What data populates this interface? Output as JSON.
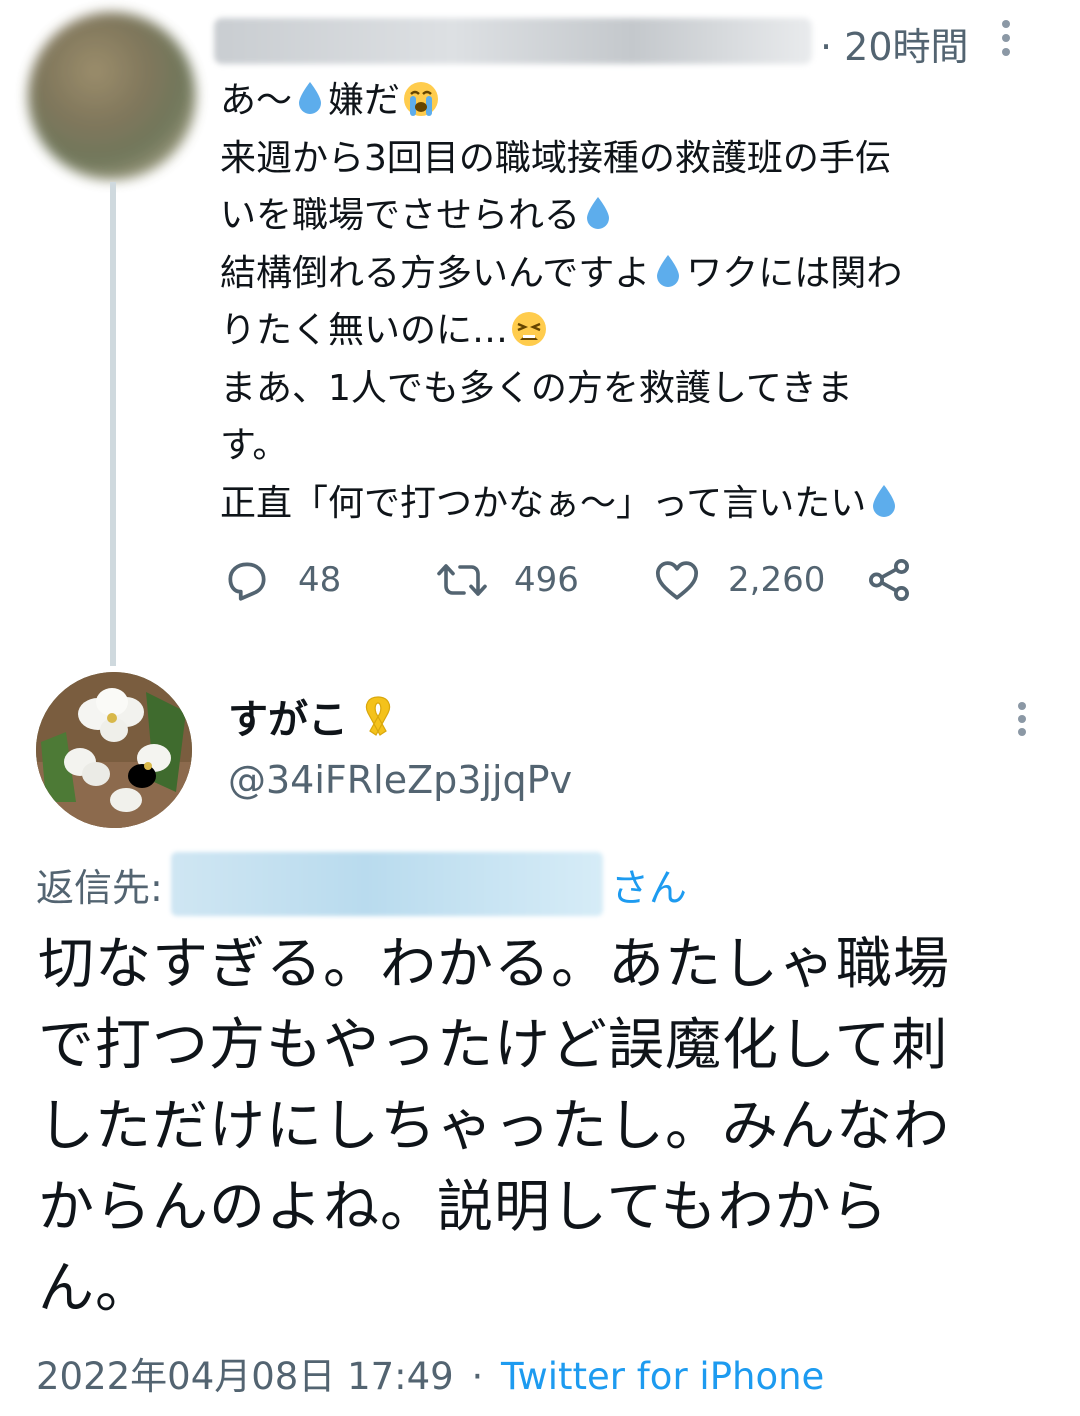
{
  "parent_tweet": {
    "time": "20時間",
    "lines": [
      [
        "あ〜",
        "嫌だ"
      ],
      [
        "来週から3回目の職域接種の救護班の手伝"
      ],
      [
        "いを職場でさせられる"
      ],
      [
        "結構倒れる方多いんですよ",
        "ワクには関わ"
      ],
      [
        "りたく無いのに…"
      ],
      [
        "まあ、1人でも多くの方を救護してきま"
      ],
      [
        "す。"
      ],
      [
        "正直「何で打つかなぁ〜」って言いたい"
      ]
    ],
    "actions": {
      "replies": "48",
      "retweets": "496",
      "likes": "2,260"
    }
  },
  "reply_tweet": {
    "name": "すがこ",
    "handle": "@34iFRleZp3jjqPv",
    "reply_to_label": "返信先:",
    "reply_to_suffix": "さん",
    "lines": [
      "切なすぎる。わかる。あたしゃ職場",
      "で打つ方もやったけど誤魔化して刺",
      "しただけにしちゃったし。みんなわ",
      "からんのよね。説明してもわから",
      "ん。"
    ],
    "date": "2022年04月08日 17:49",
    "separator": "·",
    "source": "Twitter for iPhone"
  },
  "colors": {
    "text": "#0f1419",
    "secondary": "#536471",
    "link": "#1d9bf0",
    "thread_line": "#cfd9de"
  },
  "icons": [
    "droplet-emoji",
    "loudly-crying-face-emoji",
    "weary-face-emoji",
    "reply-icon",
    "retweet-icon",
    "like-icon",
    "share-icon",
    "more-icon",
    "yellow-ribbon-emoji"
  ]
}
